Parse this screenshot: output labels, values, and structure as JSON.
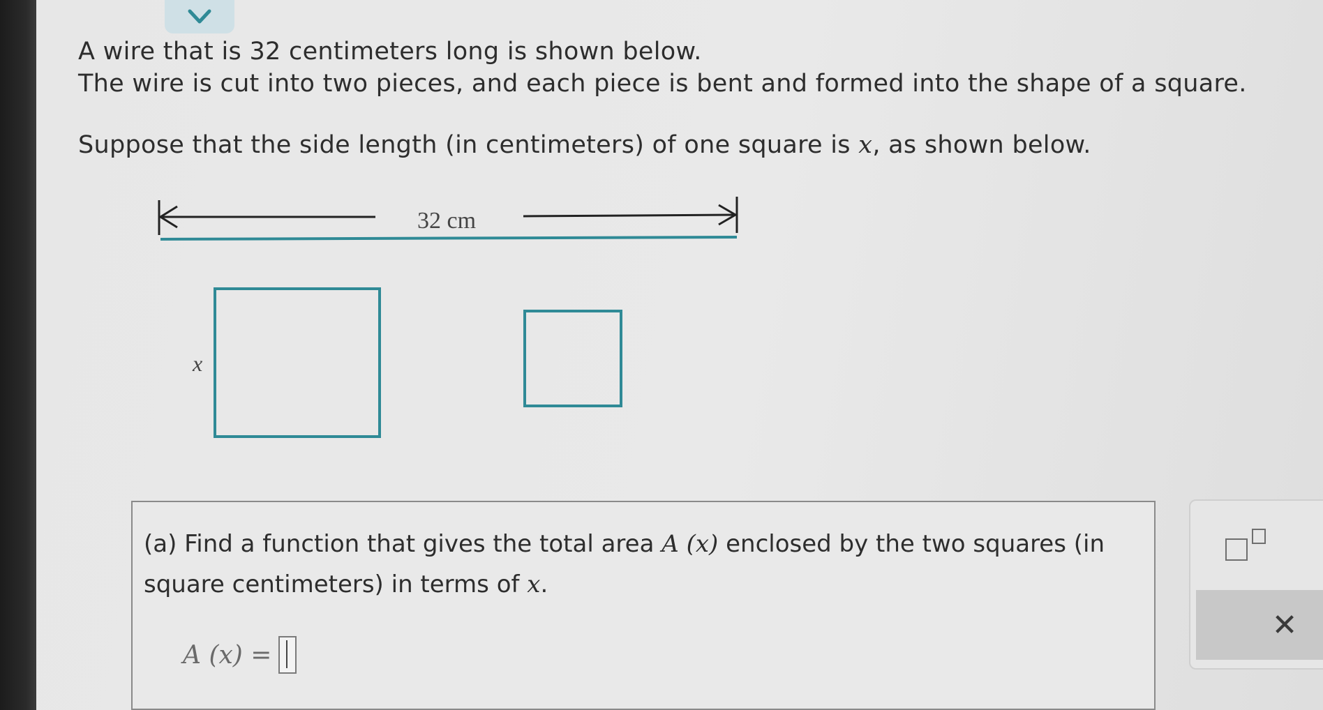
{
  "problem": {
    "line1_a": "A wire that is ",
    "line1_num": "32",
    "line1_b": " centimeters long is shown below.",
    "line2": "The wire is cut into two pieces, and each piece is bent and formed into the shape of a square.",
    "line3_a": "Suppose that the side length (in centimeters) of one square is ",
    "line3_var": "x",
    "line3_b": ", as shown below."
  },
  "figure": {
    "length_label": "32 cm",
    "side_label": "x",
    "accent_color": "#2f8a96"
  },
  "question": {
    "part_a_l1_a": "(a) Find a function that gives the total area ",
    "part_a_l1_fn": "A (x)",
    "part_a_l1_b": " enclosed by the two squares (in",
    "part_a_l2_a": "square centimeters) in terms of ",
    "part_a_l2_var": "x",
    "part_a_l2_b": ".",
    "answer_lhs": "A (x) =",
    "answer_value": ""
  },
  "toolbar": {
    "exponent_icon": "superscript-icon",
    "clear_icon": "close-icon",
    "clear_glyph": "✕"
  }
}
